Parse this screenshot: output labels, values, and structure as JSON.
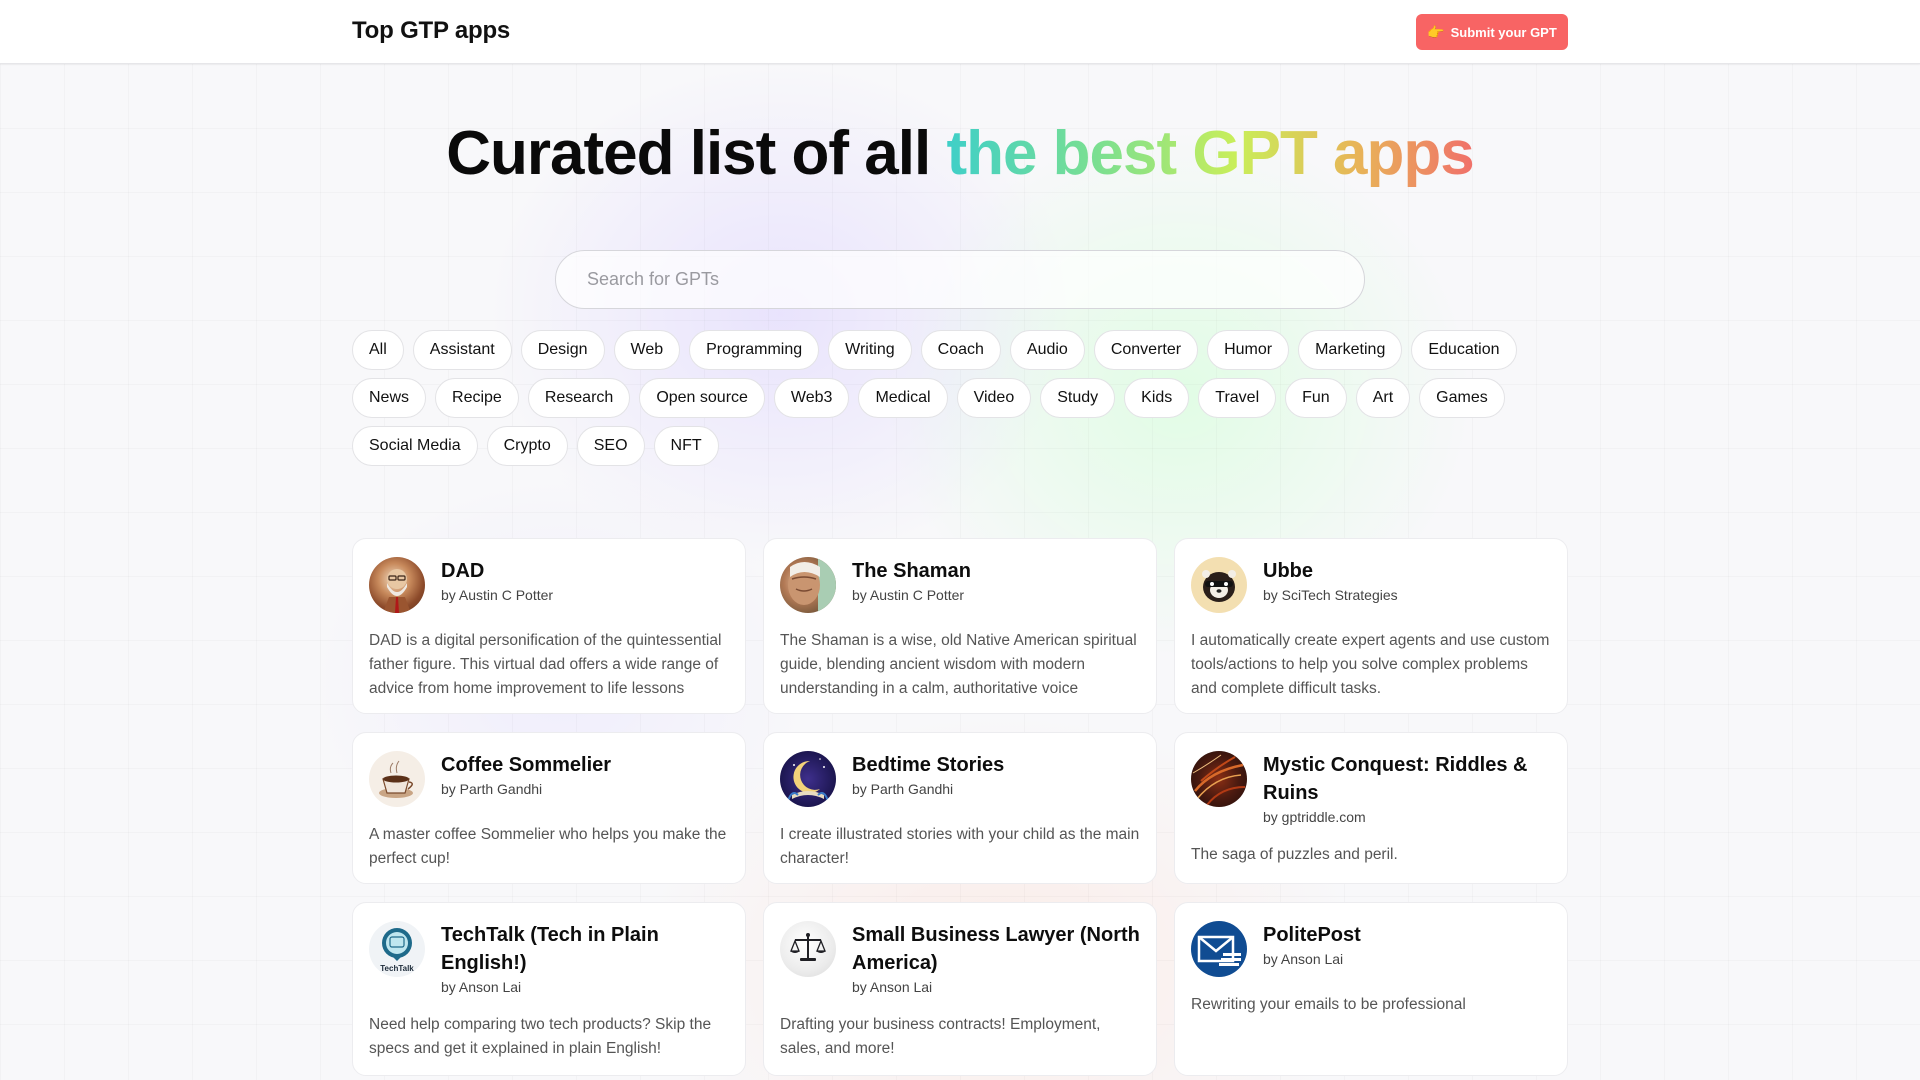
{
  "header": {
    "site_title": "Top GTP apps",
    "submit_button": {
      "icon": "pointing-hand-icon",
      "icon_glyph": "👉",
      "label": "Submit your GPT",
      "color": "#f86464"
    }
  },
  "hero": {
    "title_plain": "Curated list of all",
    "title_highlight": "the best GPT apps",
    "gradient_colors": [
      "#3fcfc8",
      "#7ee08e",
      "#c9ee5a",
      "#e8b458",
      "#f0706a"
    ]
  },
  "search": {
    "placeholder": "Search for GPTs",
    "value": ""
  },
  "categories": [
    "All",
    "Assistant",
    "Design",
    "Web",
    "Programming",
    "Writing",
    "Coach",
    "Audio",
    "Converter",
    "Humor",
    "Marketing",
    "Education",
    "News",
    "Recipe",
    "Research",
    "Open source",
    "Web3",
    "Medical",
    "Video",
    "Study",
    "Kids",
    "Travel",
    "Fun",
    "Art",
    "Games",
    "Social Media",
    "Crypto",
    "SEO",
    "NFT"
  ],
  "apps": [
    {
      "name": "DAD",
      "author": "by Austin C Potter",
      "description": "DAD is a digital personification of the quintessential father figure. This virtual dad offers a wide range of advice from home improvement to life lessons",
      "icon": "dad-avatar-icon"
    },
    {
      "name": "The Shaman",
      "author": "by Austin C Potter",
      "description": "The Shaman is a wise, old Native American spiritual guide, blending ancient wisdom with modern understanding in a calm, authoritative voice",
      "icon": "shaman-avatar-icon"
    },
    {
      "name": "Ubbe",
      "author": "by SciTech Strategies",
      "description": "I automatically create expert agents and use custom tools/actions to help you solve complex problems and complete difficult tasks.",
      "icon": "ferret-avatar-icon"
    },
    {
      "name": "Coffee Sommelier",
      "author": "by Parth Gandhi",
      "description": "A master coffee Sommelier who helps you make the perfect cup!",
      "icon": "coffee-cup-icon"
    },
    {
      "name": "Bedtime Stories",
      "author": "by Parth Gandhi",
      "description": "I create illustrated stories with your child as the main character!",
      "icon": "moon-book-icon"
    },
    {
      "name": "Mystic Conquest: Riddles & Ruins",
      "author": "by gptriddle.com",
      "description": "The saga of puzzles and peril.",
      "icon": "dragon-avatar-icon"
    },
    {
      "name": "TechTalk (Tech in Plain English!)",
      "author": "by Anson Lai",
      "description": "Need help comparing two tech products? Skip the specs and get it explained in plain English!",
      "icon": "techtalk-logo-icon",
      "icon_text": "TechTalk"
    },
    {
      "name": "Small Business Lawyer (North America)",
      "author": "by Anson Lai",
      "description": "Drafting your business contracts! Employment, sales, and more!",
      "icon": "scales-of-justice-icon"
    },
    {
      "name": "PolitePost",
      "author": "by Anson Lai",
      "description": "Rewriting your emails to be professional",
      "icon": "envelope-icon"
    }
  ]
}
